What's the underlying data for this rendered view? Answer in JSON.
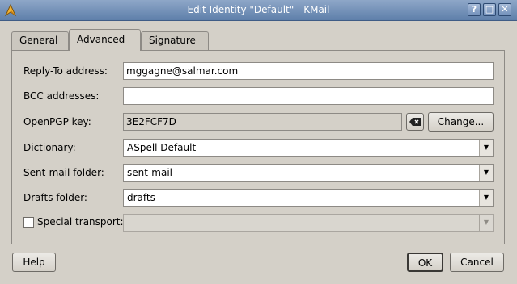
{
  "window": {
    "title": "Edit Identity \"Default\" - KMail",
    "buttons": {
      "help": "?",
      "maximize": "□",
      "close": "✕"
    }
  },
  "tabs": [
    {
      "label": "General"
    },
    {
      "label": "Advanced"
    },
    {
      "label": "Signature"
    }
  ],
  "form": {
    "reply_to": {
      "label": "Reply-To address:",
      "value": "mggagne@salmar.com"
    },
    "bcc": {
      "label": "BCC addresses:",
      "value": ""
    },
    "pgp": {
      "label": "OpenPGP key:",
      "value": "3E2FCF7D",
      "change_label": "Change..."
    },
    "dictionary": {
      "label": "Dictionary:",
      "value": "ASpell Default"
    },
    "sent_folder": {
      "label": "Sent-mail folder:",
      "value": "sent-mail"
    },
    "drafts_folder": {
      "label": "Drafts folder:",
      "value": "drafts"
    },
    "special_transport": {
      "label": "Special transport:",
      "value": "",
      "checked": false
    }
  },
  "footer": {
    "help_label": "Help",
    "ok_label": "OK",
    "cancel_label": "Cancel"
  }
}
